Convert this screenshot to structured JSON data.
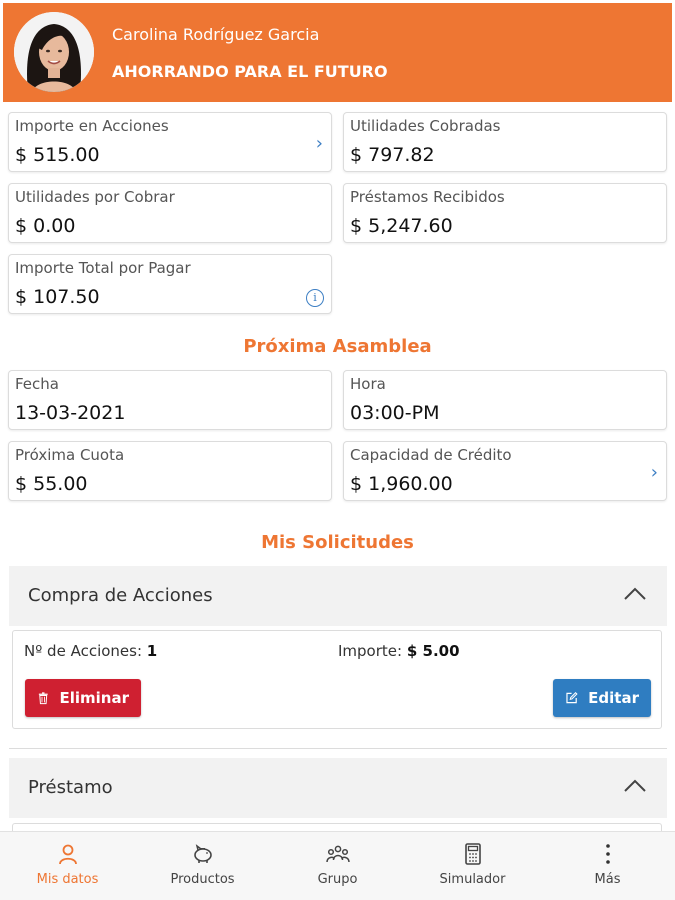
{
  "colors": {
    "accent": "#ee7633",
    "link_blue": "#3d7fc4",
    "danger": "#cf2031",
    "primary": "#2f7dc1"
  },
  "header": {
    "user_name": "Carolina Rodríguez Garcia",
    "motto": "AHORRANDO PARA EL FUTURO",
    "avatar_icon": "user-photo"
  },
  "summary": {
    "importe_acciones": {
      "label": "Importe en Acciones",
      "value": "$ 515.00"
    },
    "utilidades_cobradas": {
      "label": "Utilidades Cobradas",
      "value": "$ 797.82"
    },
    "utilidades_por_cobrar": {
      "label": "Utilidades por Cobrar",
      "value": "$ 0.00"
    },
    "prestamos_recibidos": {
      "label": "Préstamos Recibidos",
      "value": "$ 5,247.60"
    },
    "importe_total_pagar": {
      "label": "Importe Total por Pagar",
      "value": "$ 107.50"
    }
  },
  "asamblea": {
    "title": "Próxima Asamblea",
    "fecha": {
      "label": "Fecha",
      "value": "13-03-2021"
    },
    "hora": {
      "label": "Hora",
      "value": "03:00-PM"
    },
    "proxima_cuota": {
      "label": "Próxima Cuota",
      "value": "$ 55.00"
    },
    "capacidad_credito": {
      "label": "Capacidad de Crédito",
      "value": "$ 1,960.00"
    }
  },
  "solicitudes": {
    "title": "Mis Solicitudes",
    "compra": {
      "title": "Compra de Acciones",
      "acciones_label": "Nº de Acciones:",
      "acciones_value": "1",
      "importe_label": "Importe:",
      "importe_value": "$ 5.00",
      "delete_label": "Eliminar",
      "edit_label": "Editar"
    },
    "prestamo": {
      "title": "Préstamo"
    }
  },
  "tabbar": {
    "items": [
      {
        "label": "Mis datos",
        "icon": "user-icon",
        "active": true
      },
      {
        "label": "Productos",
        "icon": "piggy-bank-icon",
        "active": false
      },
      {
        "label": "Grupo",
        "icon": "group-icon",
        "active": false
      },
      {
        "label": "Simulador",
        "icon": "calculator-icon",
        "active": false
      },
      {
        "label": "Más",
        "icon": "more-vertical-icon",
        "active": false
      }
    ]
  }
}
